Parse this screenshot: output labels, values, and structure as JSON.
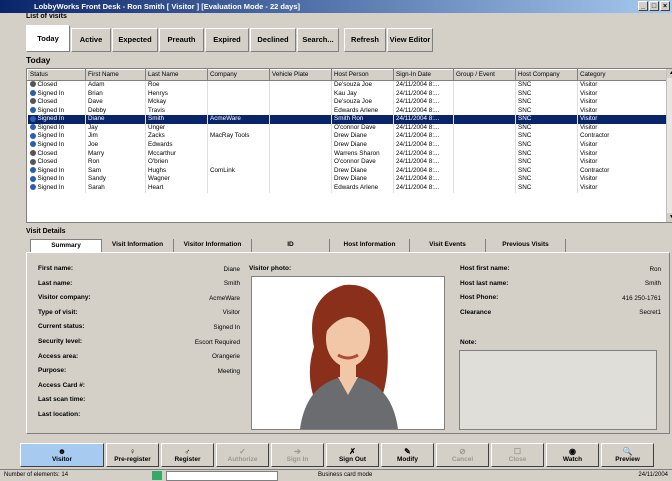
{
  "window": {
    "title": "LobbyWorks Front Desk - Ron Smith [ Visitor ] [Evaluation Mode - 22 days]",
    "buttons": [
      "_",
      "□",
      "×"
    ]
  },
  "list_label": "List of visits",
  "tabs": [
    {
      "label": "Today"
    },
    {
      "label": "Active"
    },
    {
      "label": "Expected"
    },
    {
      "label": "Preauth"
    },
    {
      "label": "Expired"
    },
    {
      "label": "Declined"
    },
    {
      "label": "Search..."
    },
    {
      "label": "Refresh"
    },
    {
      "label": "View Editor"
    }
  ],
  "section_title": "Today",
  "columns": [
    "Status",
    "First Name",
    "Last Name",
    "Company",
    "Vehicle Plate",
    "Host Person",
    "Sign-In Date",
    "Group / Event",
    "Host Company",
    "Category"
  ],
  "rows": [
    {
      "status": "Closed",
      "first": "Adam",
      "last": "Roe",
      "company": "",
      "plate": "",
      "host": "De'souza Joe",
      "date": "24/11/2004 8:...",
      "group": "",
      "hostco": "SNC",
      "cat": "Visitor"
    },
    {
      "status": "Signed In",
      "first": "Brian",
      "last": "Henrys",
      "company": "",
      "plate": "",
      "host": "Kau Jay",
      "date": "24/11/2004 8:...",
      "group": "",
      "hostco": "SNC",
      "cat": "Visitor"
    },
    {
      "status": "Closed",
      "first": "Dave",
      "last": "Mckay",
      "company": "",
      "plate": "",
      "host": "De'souza Joe",
      "date": "24/11/2004 8:...",
      "group": "",
      "hostco": "SNC",
      "cat": "Visitor"
    },
    {
      "status": "Signed In",
      "first": "Debby",
      "last": "Travis",
      "company": "",
      "plate": "",
      "host": "Edwards Arlene",
      "date": "24/11/2004 8:...",
      "group": "",
      "hostco": "SNC",
      "cat": "Visitor"
    },
    {
      "status": "Signed In",
      "first": "Diane",
      "last": "Smith",
      "company": "AcmeWare",
      "plate": "",
      "host": "Smith Ron",
      "date": "24/11/2004 8:...",
      "group": "",
      "hostco": "SNC",
      "cat": "Visitor",
      "selected": true
    },
    {
      "status": "Signed In",
      "first": "Jay",
      "last": "Unger",
      "company": "",
      "plate": "",
      "host": "O'connor Dave",
      "date": "24/11/2004 8:...",
      "group": "",
      "hostco": "SNC",
      "cat": "Visitor"
    },
    {
      "status": "Signed In",
      "first": "Jim",
      "last": "Zacks",
      "company": "MacRay Tools",
      "plate": "",
      "host": "Drew Diane",
      "date": "24/11/2004 8:...",
      "group": "",
      "hostco": "SNC",
      "cat": "Contractor"
    },
    {
      "status": "Signed In",
      "first": "Joe",
      "last": "Edwards",
      "company": "",
      "plate": "",
      "host": "Drew Diane",
      "date": "24/11/2004 8:...",
      "group": "",
      "hostco": "SNC",
      "cat": "Visitor"
    },
    {
      "status": "Closed",
      "first": "Marry",
      "last": "Mccarthur",
      "company": "",
      "plate": "",
      "host": "Warrens Sharon",
      "date": "24/11/2004 8:...",
      "group": "",
      "hostco": "SNC",
      "cat": "Visitor"
    },
    {
      "status": "Closed",
      "first": "Ron",
      "last": "O'brien",
      "company": "",
      "plate": "",
      "host": "O'connor Dave",
      "date": "24/11/2004 8:...",
      "group": "",
      "hostco": "SNC",
      "cat": "Visitor"
    },
    {
      "status": "Signed In",
      "first": "Sam",
      "last": "Hughs",
      "company": "ComLink",
      "plate": "",
      "host": "Drew Diane",
      "date": "24/11/2004 8:...",
      "group": "",
      "hostco": "SNC",
      "cat": "Contractor"
    },
    {
      "status": "Signed In",
      "first": "Sandy",
      "last": "Wagner",
      "company": "",
      "plate": "",
      "host": "Drew Diane",
      "date": "24/11/2004 8:...",
      "group": "",
      "hostco": "SNC",
      "cat": "Visitor"
    },
    {
      "status": "Signed In",
      "first": "Sarah",
      "last": "Heart",
      "company": "",
      "plate": "",
      "host": "Edwards Arlene",
      "date": "24/11/2004 8:...",
      "group": "",
      "hostco": "SNC",
      "cat": "Visitor"
    }
  ],
  "details_label": "Visit Details",
  "detail_tabs": [
    "Summary",
    "Visit Information",
    "Visitor Information",
    "ID",
    "Host Information",
    "Visit Events",
    "Previous Visits"
  ],
  "summary": {
    "fields": [
      {
        "label": "First name:",
        "value": "Diane"
      },
      {
        "label": "Last name:",
        "value": "Smith"
      },
      {
        "label": "Visitor company:",
        "value": "AcmeWare"
      },
      {
        "label": "Type of visit:",
        "value": "Visitor"
      },
      {
        "label": "Current status:",
        "value": "Signed In"
      },
      {
        "label": "Security level:",
        "value": "Escort Required"
      },
      {
        "label": "Access area:",
        "value": "Orangerie"
      },
      {
        "label": "Purpose:",
        "value": "Meeting"
      },
      {
        "label": "Access Card #:",
        "value": ""
      },
      {
        "label": "Last scan time:",
        "value": ""
      },
      {
        "label": "Last location:",
        "value": ""
      }
    ],
    "photo_label": "Visitor photo:",
    "host_fields": [
      {
        "label": "Host first name:",
        "value": "Ron"
      },
      {
        "label": "Host last name:",
        "value": "Smith"
      },
      {
        "label": "Host Phone:",
        "value": "416 250-1761"
      },
      {
        "label": "Clearance",
        "value": "Secret1"
      }
    ],
    "note_label": "Note:"
  },
  "toolbar": [
    {
      "label": "Visitor",
      "enabled": true
    },
    {
      "label": "Pre-register",
      "enabled": true
    },
    {
      "label": "Register",
      "enabled": true
    },
    {
      "label": "Authorize",
      "enabled": false
    },
    {
      "label": "Sign In",
      "enabled": false
    },
    {
      "label": "Sign Out",
      "enabled": true
    },
    {
      "label": "Modify",
      "enabled": true
    },
    {
      "label": "Cancel",
      "enabled": false
    },
    {
      "label": "Close",
      "enabled": false
    },
    {
      "label": "Watch",
      "enabled": true
    },
    {
      "label": "Preview",
      "enabled": true
    }
  ],
  "status": {
    "count": "Number of elements: 14",
    "mode": "Business card mode",
    "date": "24/11/2004"
  }
}
